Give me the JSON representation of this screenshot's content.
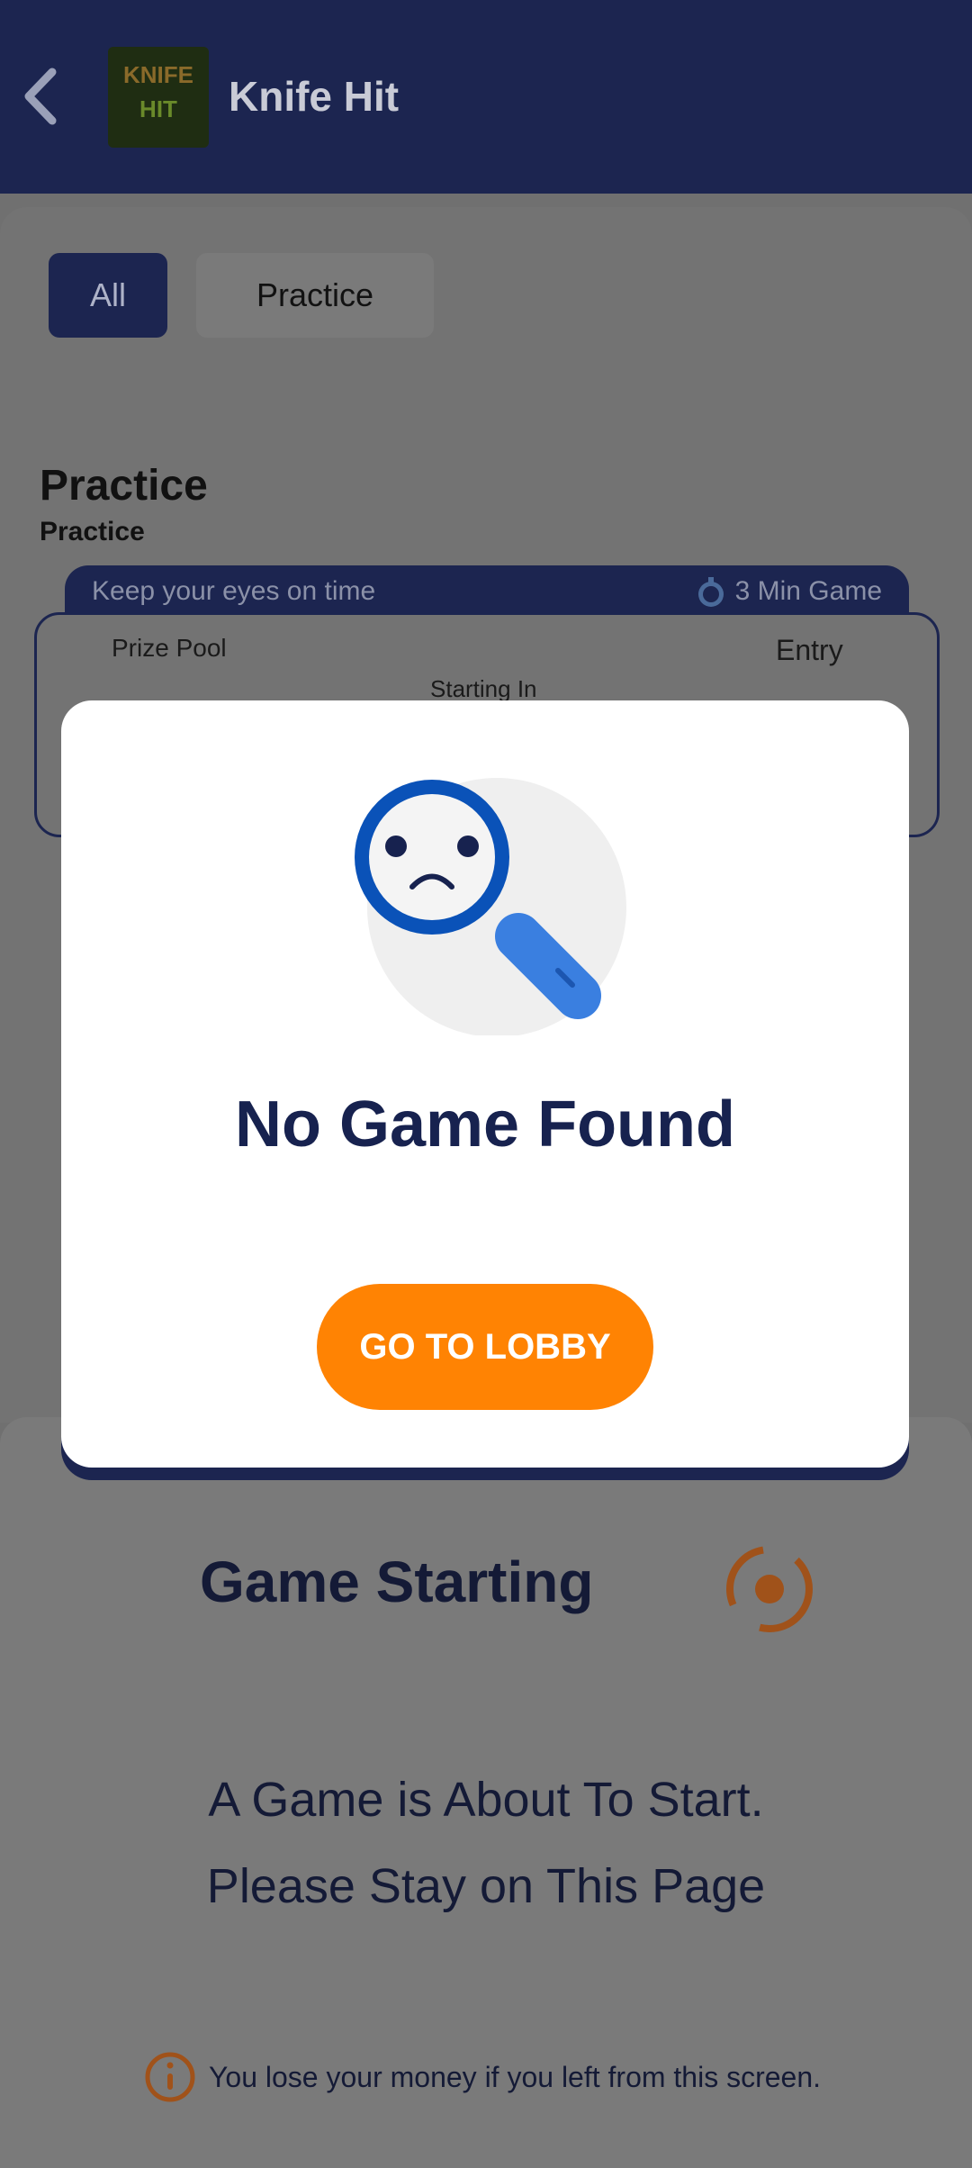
{
  "header": {
    "title": "Knife Hit",
    "back_icon": "back-arrow-icon",
    "thumb_text": "KNIFE HIT"
  },
  "tabs": [
    {
      "label": "All"
    },
    {
      "label": "Practice"
    }
  ],
  "section": {
    "title": "Practice",
    "subtitle": "Practice"
  },
  "contest": {
    "strip_left": "Keep your eyes on time",
    "strip_right": "3 Min Game",
    "prize_label": "Prize Pool",
    "entry_label": "Entry",
    "starting_label": "Starting In"
  },
  "bottom": {
    "title": "Game Starting",
    "line1": "A Game is About To Start.",
    "line2": "Please Stay on This Page",
    "warning": "You lose your money if you left from this screen."
  },
  "modal": {
    "title": "No Game Found",
    "button": "GO TO LOBBY",
    "icon": "sad-magnifier-icon"
  },
  "colors": {
    "navy": "#1c2550",
    "orange": "#ff8303",
    "overlay": "#707070"
  }
}
